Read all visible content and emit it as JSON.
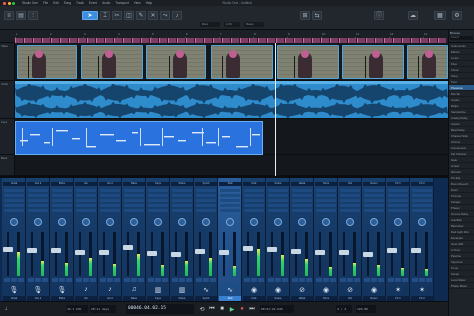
{
  "window": {
    "title": "Studio One - Untitled",
    "traffic_lights": [
      "#ff5f57",
      "#febc2e",
      "#28c840"
    ]
  },
  "menubar": {
    "items": [
      "Studio One",
      "File",
      "Edit",
      "Song",
      "Track",
      "Event",
      "Audio",
      "Transport",
      "View",
      "Help"
    ]
  },
  "toolbar": {
    "tools": [
      "arrow-tool-icon",
      "range-tool-icon",
      "split-tool-icon",
      "eraser-tool-icon",
      "paint-tool-icon",
      "mute-tool-icon",
      "bend-tool-icon",
      "listen-tool-icon"
    ],
    "grid_label": "Bars",
    "quantize_label": "1/16",
    "timebase_label": "Beats"
  },
  "ruler": {
    "bars": [
      "1",
      "2",
      "3",
      "4",
      "5",
      "6",
      "7",
      "8",
      "9",
      "10",
      "11",
      "12",
      "13"
    ]
  },
  "tracks": [
    {
      "name": "Video"
    },
    {
      "name": "Vocal"
    },
    {
      "name": "Keys"
    },
    {
      "name": "Bass"
    }
  ],
  "browser": {
    "title": "Browse",
    "search_placeholder": "Search",
    "items": [
      "Instruments",
      "Effects",
      "Loops",
      "Files",
      "Cloud",
      "Shop",
      "Pool",
      "Presence",
      "Mai Tai",
      "Impact",
      "Mojito",
      "SampleOne",
      "Analog Delay",
      "Ampire",
      "Beat Delay",
      "Channel Strip",
      "Chorus",
      "Compressor",
      "Fat Channel",
      "Gate",
      "Limiter",
      "Mixverb",
      "Pro EQ",
      "Room Reverb",
      "Rotor",
      "Tricomp",
      "Flanger",
      "Phaser",
      "Groove Delay",
      "Autofilter",
      "Bitcrusher",
      "Red Light Dist",
      "Expander",
      "Open AIR",
      "X-Trem",
      "Pipeline",
      "Spectrum",
      "Tuner",
      "Scope",
      "Level Meter",
      "Phase Meter"
    ],
    "selected_index": 7
  },
  "console": {
    "channels": [
      {
        "name": "Vocal",
        "icon": "mic-icon",
        "fader": 0.62,
        "meter": 0.55
      },
      {
        "name": "Vox 2",
        "icon": "mic-icon",
        "fader": 0.58,
        "meter": 0.35
      },
      {
        "name": "BVox",
        "icon": "mic-icon",
        "fader": 0.6,
        "meter": 0.3
      },
      {
        "name": "Gtr",
        "icon": "guitar-icon",
        "fader": 0.55,
        "meter": 0.42
      },
      {
        "name": "Gtr 2",
        "icon": "guitar-icon",
        "fader": 0.55,
        "meter": 0.28
      },
      {
        "name": "Bass",
        "icon": "bass-icon",
        "fader": 0.66,
        "meter": 0.5
      },
      {
        "name": "Keys",
        "icon": "keys-icon",
        "fader": 0.52,
        "meter": 0.25
      },
      {
        "name": "Piano",
        "icon": "keys-icon",
        "fader": 0.5,
        "meter": 0.33
      },
      {
        "name": "Synth",
        "icon": "synth-icon",
        "fader": 0.57,
        "meter": 0.4
      },
      {
        "name": "Pad",
        "icon": "synth-icon",
        "fader": 0.54,
        "meter": 0.22
      },
      {
        "name": "Kick",
        "icon": "drum-icon",
        "fader": 0.63,
        "meter": 0.61
      },
      {
        "name": "Snare",
        "icon": "drum-icon",
        "fader": 0.61,
        "meter": 0.47
      },
      {
        "name": "HiHat",
        "icon": "cymbal-icon",
        "fader": 0.56,
        "meter": 0.38
      },
      {
        "name": "Toms",
        "icon": "drum-icon",
        "fader": 0.53,
        "meter": 0.2
      },
      {
        "name": "OH",
        "icon": "cymbal-icon",
        "fader": 0.55,
        "meter": 0.3
      },
      {
        "name": "Room",
        "icon": "drum-icon",
        "fader": 0.5,
        "meter": 0.26
      },
      {
        "name": "FX 1",
        "icon": "fx-icon",
        "fader": 0.58,
        "meter": 0.18
      },
      {
        "name": "FX 2",
        "icon": "fx-icon",
        "fader": 0.58,
        "meter": 0.15
      }
    ],
    "selected_index": 9
  },
  "transport": {
    "position": "00046.04.02.15",
    "time": "00:01:22.645",
    "sample_rate": "44.1 kHz",
    "record_time": "28:11 days",
    "tempo": "120.00",
    "signature": "4 / 4"
  }
}
